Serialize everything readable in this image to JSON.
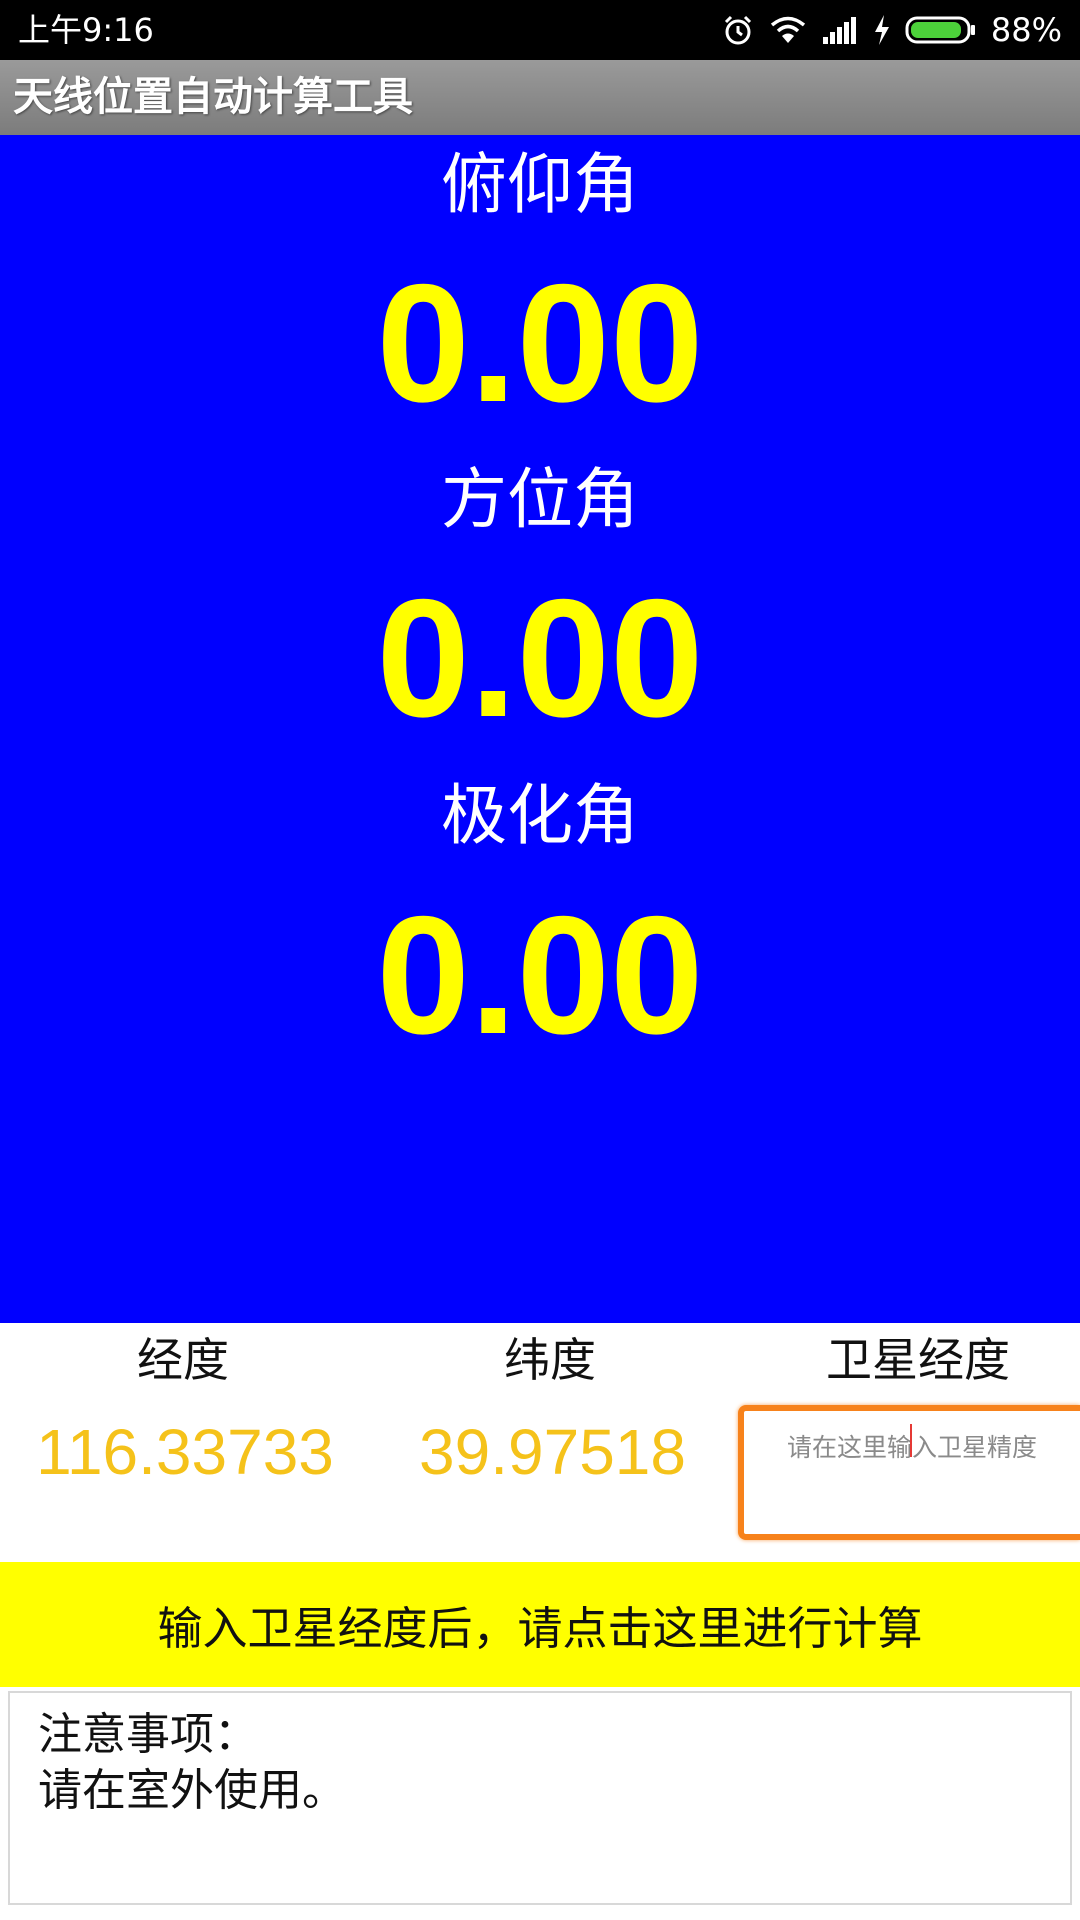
{
  "status_bar": {
    "time": "上午9:16",
    "battery_percent": "88%",
    "icons": [
      "alarm-icon",
      "wifi-icon",
      "signal-icon",
      "charging-icon",
      "battery-icon"
    ]
  },
  "app": {
    "title": "天线位置自动计算工具"
  },
  "results": {
    "elevation": {
      "label": "俯仰角",
      "value": "0.00"
    },
    "azimuth": {
      "label": "方位角",
      "value": "0.00"
    },
    "polarization": {
      "label": "极化角",
      "value": "0.00"
    }
  },
  "inputs": {
    "longitude": {
      "label": "经度",
      "value": "116.33733"
    },
    "latitude": {
      "label": "纬度",
      "value": "39.97518"
    },
    "satellite_longitude": {
      "label": "卫星经度",
      "placeholder": "请在这里输入卫星精度",
      "value": ""
    }
  },
  "calculate_button": {
    "label": "输入卫星经度后，请点击这里进行计算"
  },
  "notes": {
    "title": "注意事项：",
    "text": "请在室外使用。"
  },
  "colors": {
    "panel_bg": "#0000ff",
    "value_color": "#ffff00",
    "coord_color": "#f5c21a",
    "button_bg": "#ffff00",
    "input_border": "#f7821b"
  }
}
